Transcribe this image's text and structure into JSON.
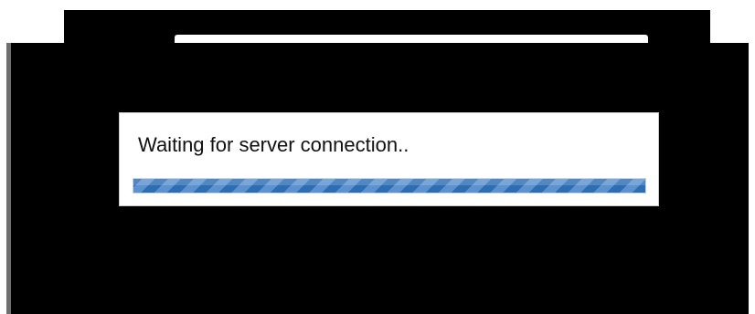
{
  "dialog": {
    "message": "Waiting for server connection..",
    "progress": {
      "fraction": 1.0,
      "style": "indeterminate-striped",
      "color": "#2e6fb6"
    }
  },
  "colors": {
    "background_overlay": "#000000",
    "dialog_background": "#ffffff",
    "side_bar": "#6f6f6f"
  }
}
